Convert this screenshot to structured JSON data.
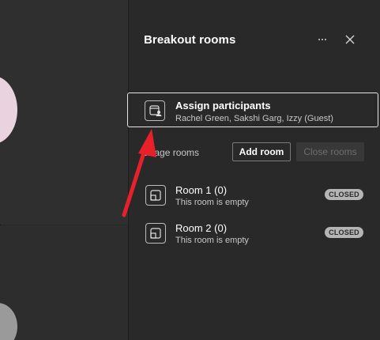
{
  "panel": {
    "title": "Breakout rooms"
  },
  "header_icons": {
    "more": "more-options-icon",
    "close": "close-icon"
  },
  "assign": {
    "title": "Assign participants",
    "subtitle": "Rachel Green, Sakshi Garg, Izzy (Guest)",
    "icon": "assign-participants-icon"
  },
  "manage": {
    "label": "anage rooms",
    "add_room": "Add room",
    "close_rooms": "Close rooms"
  },
  "rooms": [
    {
      "name": "Room 1 (0)",
      "status": "This room is empty",
      "badge": "CLOSED",
      "icon": "room-icon"
    },
    {
      "name": "Room 2 (0)",
      "status": "This room is empty",
      "badge": "CLOSED",
      "icon": "room-icon"
    }
  ],
  "colors": {
    "background": "#292929",
    "accent_arrow": "#e8202a",
    "badge": "#b5b5b5"
  }
}
